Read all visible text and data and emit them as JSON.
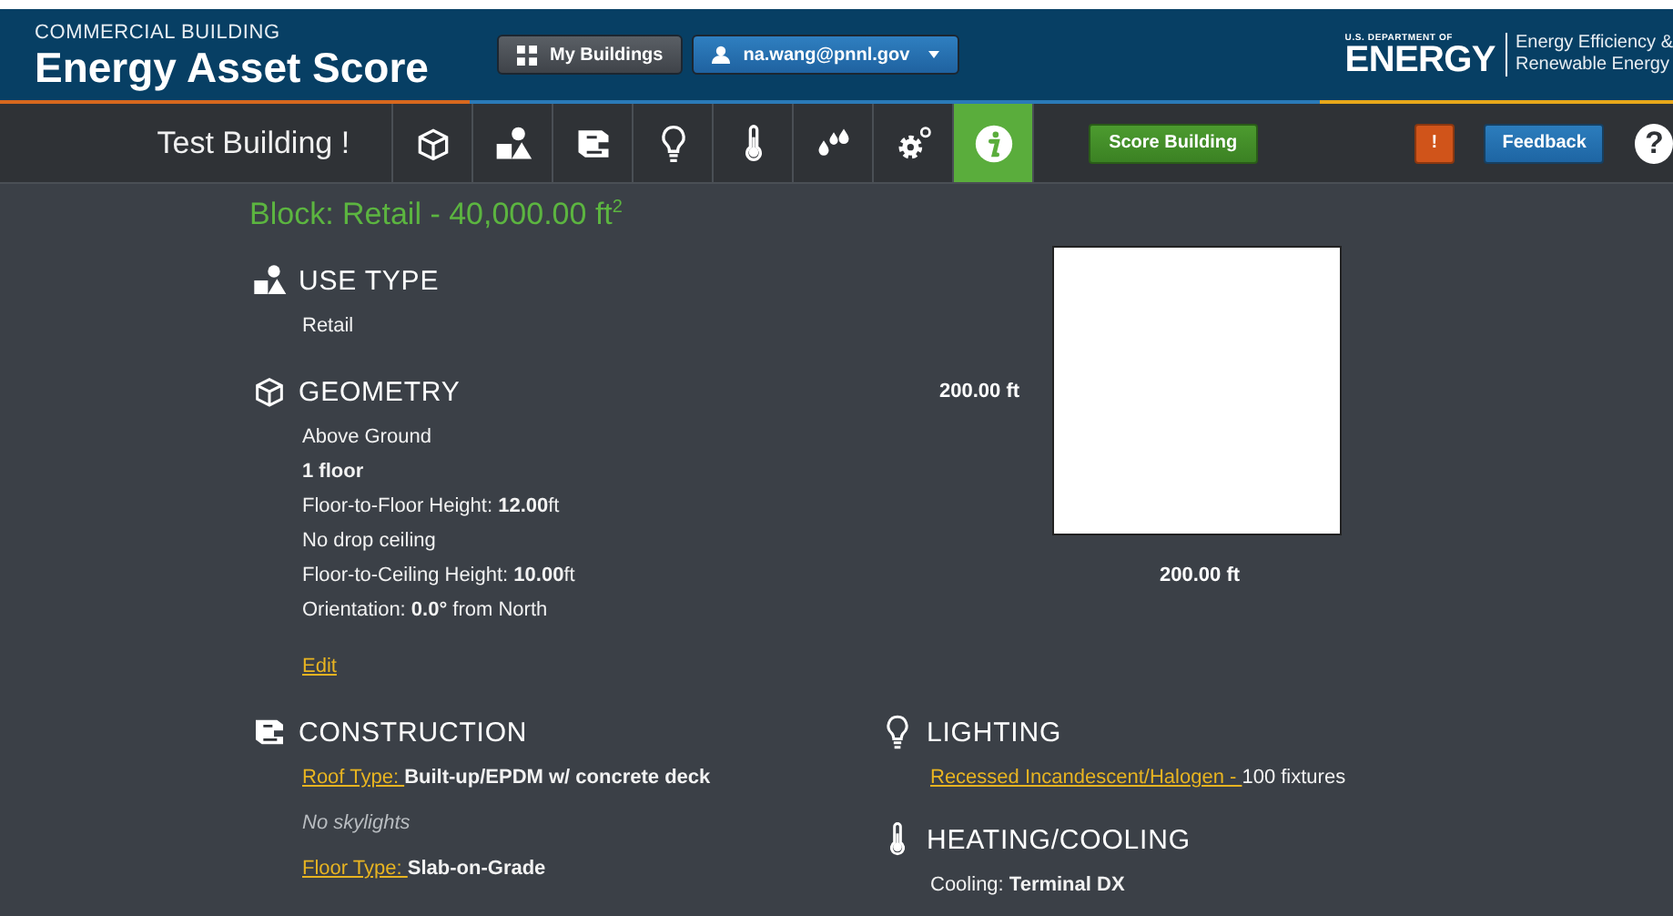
{
  "header": {
    "subtitle": "COMMERCIAL BUILDING",
    "title": "Energy Asset Score",
    "my_buildings_button": "My Buildings",
    "user_button": "na.wang@pnnl.gov",
    "agency_logo": {
      "department": "U.S. DEPARTMENT OF",
      "name": "ENERGY",
      "office_lines": [
        "Energy Efficiency &",
        "Renewable Energy"
      ]
    }
  },
  "nav": {
    "building_name": "Test Building !",
    "tabs": [
      {
        "kind": "geometry",
        "selected": false
      },
      {
        "kind": "use_type",
        "selected": false
      },
      {
        "kind": "construction",
        "selected": false
      },
      {
        "kind": "lighting",
        "selected": false
      },
      {
        "kind": "hvac",
        "selected": false
      },
      {
        "kind": "water",
        "selected": false
      },
      {
        "kind": "systems",
        "selected": false
      },
      {
        "kind": "info",
        "selected": true
      }
    ],
    "score_button": "Score Building",
    "alert_button": "!",
    "feedback_button": "Feedback",
    "help_button": "?"
  },
  "block_title": "Block: Retail - 40,000.00 ft$^{2}$",
  "footprint": {
    "side_label": "200.00 ft",
    "bottom_label": "200.00 ft"
  },
  "left_column": [
    {
      "kind": "use_type",
      "title": "USE TYPE",
      "lines": [
        {
          "kind": "text",
          "text": "Retail"
        }
      ]
    },
    {
      "kind": "geometry",
      "title": "GEOMETRY",
      "lines": [
        {
          "kind": "text",
          "text": "Above Ground"
        },
        {
          "kind": "strong",
          "text": "1 floor"
        },
        {
          "kind": "text",
          "text": "Floor-to-Floor Height: **12.00**ft"
        },
        {
          "kind": "text",
          "text": "No drop ceiling"
        },
        {
          "kind": "text",
          "text": "Floor-to-Ceiling Height: **10.00**ft"
        },
        {
          "kind": "text",
          "text": "Orientation: **0.0°** from North"
        },
        {
          "kind": "action",
          "text": "Edit"
        }
      ]
    },
    {
      "kind": "construction",
      "title": "CONSTRUCTION",
      "lines": [
        {
          "kind": "link_value",
          "link": "Roof Type: ",
          "value": "**Built-up/EPDM w/ concrete deck**"
        },
        {
          "kind": "note",
          "text": "No skylights"
        },
        {
          "kind": "link_value",
          "link": "Floor Type: ",
          "value": "**Slab-on-Grade**"
        }
      ]
    }
  ],
  "right_column": [
    {
      "kind": "lighting",
      "title": "LIGHTING",
      "lines": [
        {
          "kind": "link_value",
          "link": "Recessed Incandescent/Halogen - ",
          "value": "100 fixtures"
        }
      ]
    },
    {
      "kind": "hvac",
      "title": "HEATING/COOLING",
      "lines": [
        {
          "kind": "text",
          "text": "Cooling: **Terminal DX**"
        }
      ]
    }
  ]
}
